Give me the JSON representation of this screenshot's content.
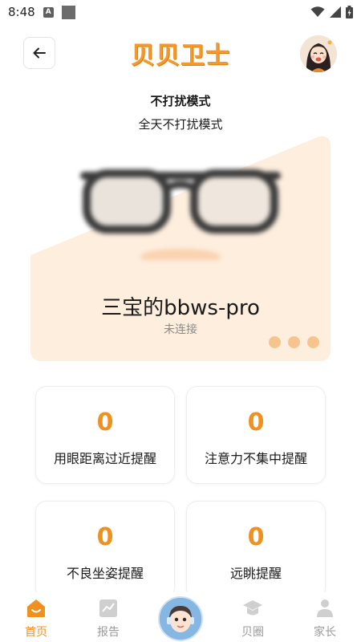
{
  "status_bar": {
    "time": "8:48",
    "notif_icon_letter": "A"
  },
  "header": {
    "logo_text": "贝贝卫士"
  },
  "mode": {
    "title": "不打扰模式",
    "subtitle": "全天不打扰模式"
  },
  "device": {
    "name": "三宝的bbws-pro",
    "status": "未连接",
    "pager_dots": 3
  },
  "stats": [
    {
      "value": "0",
      "label": "用眼距离过近提醒"
    },
    {
      "value": "0",
      "label": "注意力不集中提醒"
    },
    {
      "value": "0",
      "label": "不良坐姿提醒"
    },
    {
      "value": "0",
      "label": "远眺提醒"
    }
  ],
  "nav": {
    "items": [
      {
        "label": "首页",
        "icon": "home-icon",
        "active": true
      },
      {
        "label": "报告",
        "icon": "chart-icon",
        "active": false
      },
      {
        "label": "贝圈",
        "icon": "graduation-cap-icon",
        "active": false
      },
      {
        "label": "家长",
        "icon": "person-icon",
        "active": false
      }
    ]
  },
  "colors": {
    "accent": "#f0901e",
    "card_bg": "#fdeede",
    "inactive": "#9a9a9a"
  }
}
